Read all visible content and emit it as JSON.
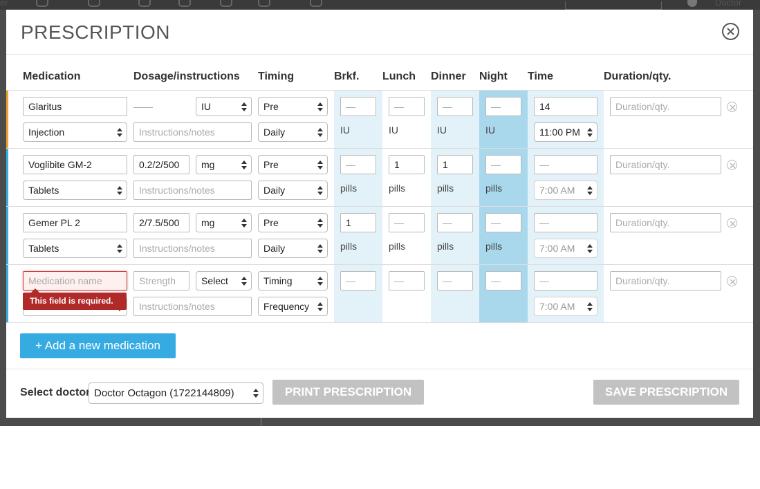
{
  "backdrop": {
    "left_fragment": "er",
    "right_fragment": "Doctor"
  },
  "modal": {
    "title": "PRESCRIPTION"
  },
  "columns": {
    "medication": "Medication",
    "dosage": "Dosage/instructions",
    "timing": "Timing",
    "breakfast": "Brkf.",
    "lunch": "Lunch",
    "dinner": "Dinner",
    "night": "Night",
    "time": "Time",
    "duration": "Duration/qty."
  },
  "placeholders": {
    "medication_name": "Medication name",
    "strength": "Strength",
    "instructions": "Instructions/notes",
    "duration": "Duration/qty.",
    "empty_dose": "—"
  },
  "rows": [
    {
      "name": "Glaritus",
      "form": "Injection",
      "strength": "——",
      "unit": "IU",
      "timing": "Pre",
      "frequency": "Daily",
      "doses": [
        "—",
        "—",
        "—",
        "—"
      ],
      "dose_unit": "IU",
      "time_value": "14",
      "time": "11:00 PM",
      "marker_color": "#f0a030"
    },
    {
      "name": "Voglibite GM-2",
      "form": "Tablets",
      "strength": "0.2/2/500",
      "unit": "mg",
      "timing": "Pre",
      "frequency": "Daily",
      "doses": [
        "—",
        "1",
        "1",
        "—"
      ],
      "dose_unit": "pills",
      "time_value": "—",
      "time": "7:00 AM",
      "marker_color": "#35abe2"
    },
    {
      "name": "Gemer PL 2",
      "form": "Tablets",
      "strength": "2/7.5/500",
      "unit": "mg",
      "timing": "Pre",
      "frequency": "Daily",
      "doses": [
        "1",
        "—",
        "—",
        "—"
      ],
      "dose_unit": "pills",
      "time_value": "—",
      "time": "7:00 AM",
      "marker_color": "#35abe2"
    },
    {
      "name": "",
      "form": "",
      "strength": "",
      "unit": "Select",
      "timing": "Timing",
      "frequency": "Frequency",
      "doses": [
        "—",
        "—",
        "—",
        "—"
      ],
      "dose_unit": "",
      "time_value": "—",
      "time": "7:00 AM",
      "marker_color": "#35abe2"
    }
  ],
  "validation": {
    "required": "This field is required."
  },
  "actions": {
    "add_medication": "+ Add a new medication",
    "select_doctor_label": "Select doctor",
    "doctor": "Doctor Octagon (1722144809)",
    "print": "PRINT PRESCRIPTION",
    "save": "SAVE PRESCRIPTION"
  },
  "colors": {
    "band_light": "#e3f2f9",
    "band_dark": "#a9d7ec",
    "accent": "#35abe2",
    "error": "#b02a2a"
  }
}
